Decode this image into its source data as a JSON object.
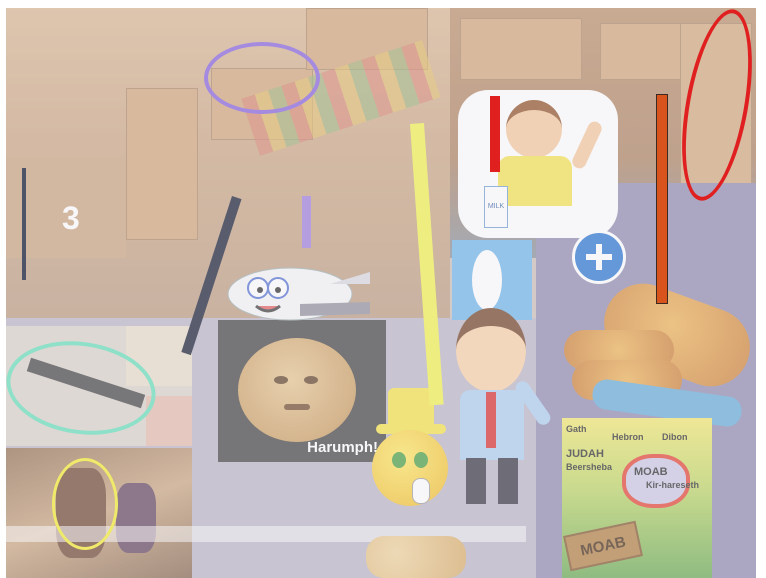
{
  "slide": {
    "number": "3",
    "cookie_caption": "Harumph!",
    "milk_label": "MILK",
    "map_labels": {
      "gath": "Gath",
      "hebron": "Hebron",
      "dibon": "Dibon",
      "judah": "JUDAH",
      "beersheba": "Beersheba",
      "moab": "MOAB",
      "kir_hareseth": "Kir-hareseth",
      "moab_sign": "MOAB"
    }
  },
  "colors": {
    "purple_ellipse": "#a58be0",
    "red_ellipse": "#e02020",
    "teal_ellipse": "#8fe0c8",
    "yellow_ellipse": "#f0ea6a",
    "yellow_bar": "#eeee80",
    "orange_bar": "#d9541c",
    "red_bar": "#e01f1f",
    "lavender_bar": "#b59ee0",
    "dark_bar": "#4e5368"
  },
  "icons": [
    "plus-icon",
    "airplane-icon",
    "emoji-thinking-icon",
    "boy-with-milk-icon",
    "businessman-icon"
  ]
}
